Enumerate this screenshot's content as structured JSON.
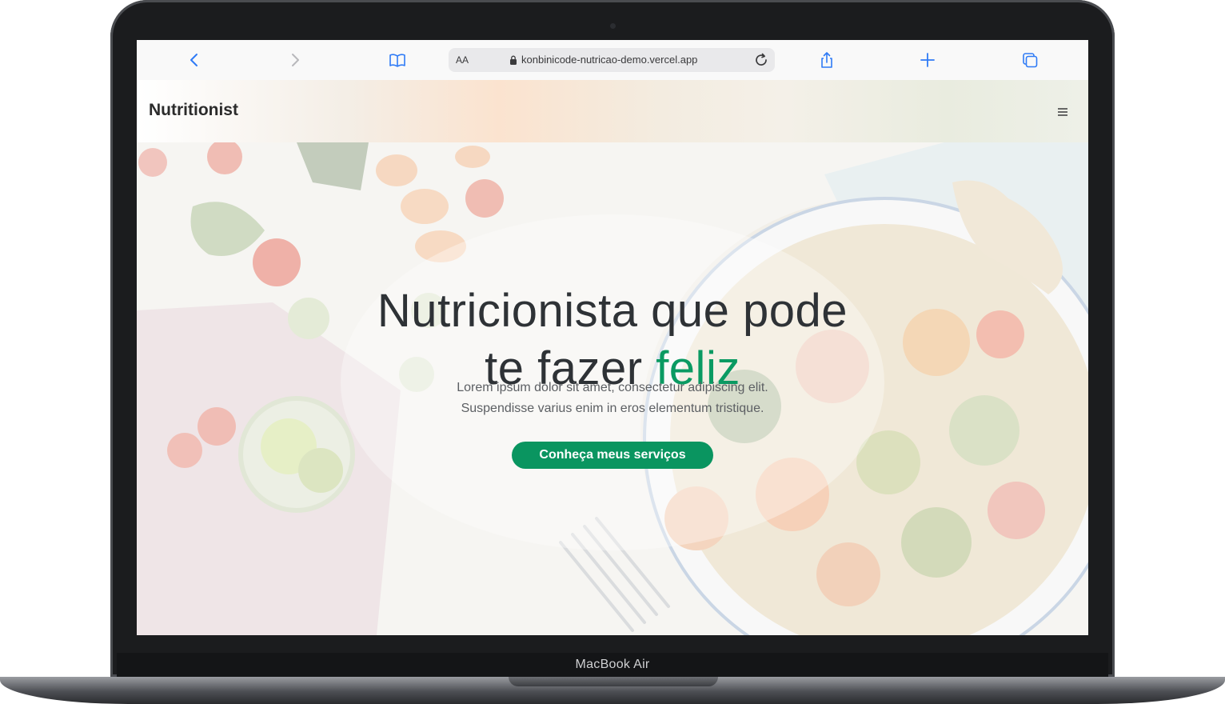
{
  "device": {
    "label": "MacBook Air"
  },
  "browser": {
    "text_size_label": "AA",
    "url": "konbinicode-nutricao-demo.vercel.app",
    "icons": {
      "back": "chevron-left-icon",
      "forward": "chevron-right-icon",
      "bookmarks": "book-icon",
      "lock": "lock-icon",
      "reload": "reload-icon",
      "share": "share-icon",
      "new_tab": "plus-icon",
      "tabs": "tabs-icon"
    },
    "accent_color": "#2f7bf6"
  },
  "site": {
    "brand": "Nutritionist",
    "menu_icon": "hamburger-menu-icon"
  },
  "hero": {
    "title_line1": "Nutricionista que pode",
    "title_line2_prefix": "te fazer ",
    "title_accent": "feliz",
    "subtitle_line1": "Lorem ipsum dolor sit amet, consectetur adipiscing elit.",
    "subtitle_line2": "Suspendisse varius enim in eros elementum tristique.",
    "cta_label": "Conheça meus serviços",
    "accent_color": "#0a9a62",
    "button_color": "#0a9560"
  }
}
